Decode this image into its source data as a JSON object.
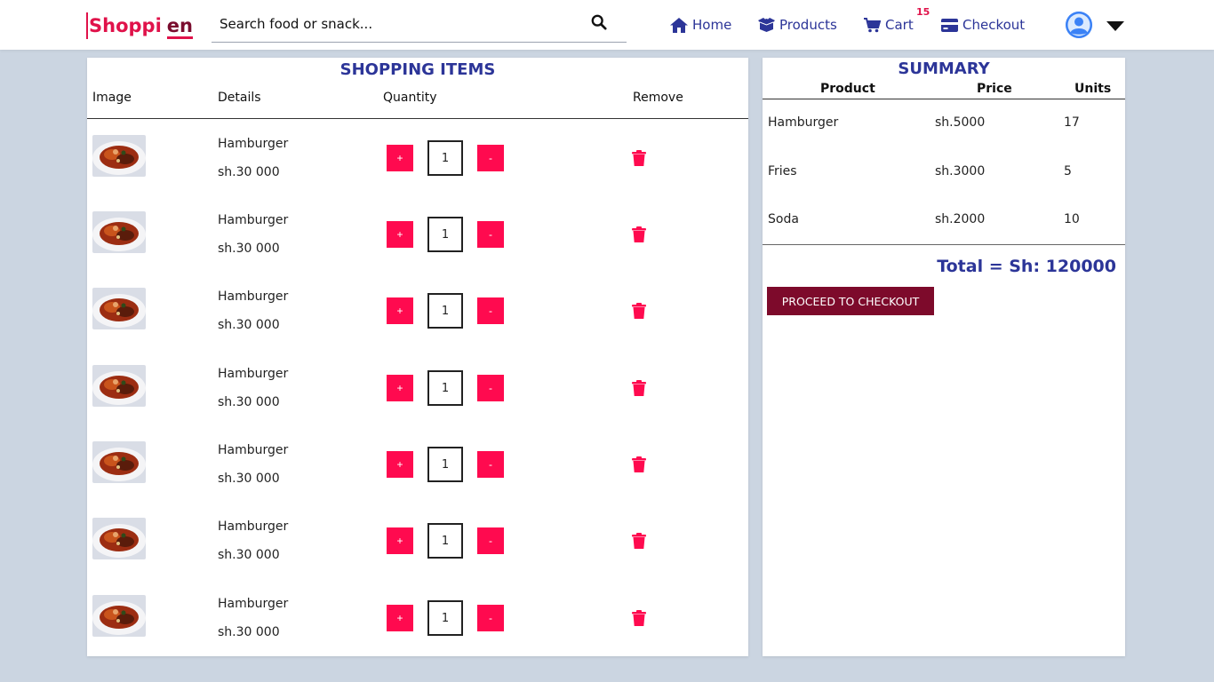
{
  "brand": {
    "part1": "Shoppi",
    "part2": "en"
  },
  "search": {
    "placeholder": "Search food or snack..."
  },
  "nav": {
    "home": "Home",
    "products": "Products",
    "cart": "Cart",
    "cart_count": "15",
    "checkout": "Checkout"
  },
  "colors": {
    "accent": "#ff0a4f",
    "brand_blue": "#2c3598",
    "checkout_btn": "#7d0a2b",
    "background": "#cbd5e1"
  },
  "cart": {
    "title": "SHOPPING ITEMS",
    "headers": {
      "image": "Image",
      "details": "Details",
      "quantity": "Quantity",
      "remove": "Remove"
    },
    "plus_label": "+",
    "minus_label": "-",
    "items": [
      {
        "name": "Hamburger",
        "price": "sh.30 000",
        "qty": "1"
      },
      {
        "name": "Hamburger",
        "price": "sh.30 000",
        "qty": "1"
      },
      {
        "name": "Hamburger",
        "price": "sh.30 000",
        "qty": "1"
      },
      {
        "name": "Hamburger",
        "price": "sh.30 000",
        "qty": "1"
      },
      {
        "name": "Hamburger",
        "price": "sh.30 000",
        "qty": "1"
      },
      {
        "name": "Hamburger",
        "price": "sh.30 000",
        "qty": "1"
      },
      {
        "name": "Hamburger",
        "price": "sh.30 000",
        "qty": "1"
      }
    ]
  },
  "summary": {
    "title": "SUMMARY",
    "headers": {
      "product": "Product",
      "price": "Price",
      "units": "Units"
    },
    "rows": [
      {
        "product": "Hamburger",
        "price": "sh.5000",
        "units": "17"
      },
      {
        "product": "Fries",
        "price": "sh.3000",
        "units": "5"
      },
      {
        "product": "Soda",
        "price": "sh.2000",
        "units": "10"
      }
    ],
    "total": "Total = Sh: 120000",
    "checkout_label": "PROCEED TO CHECKOUT"
  }
}
